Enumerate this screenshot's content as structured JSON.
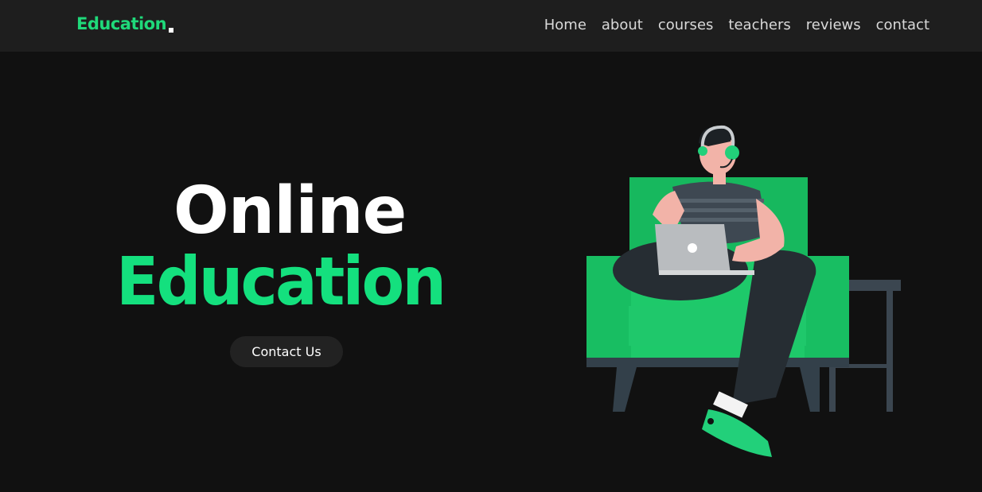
{
  "header": {
    "logo_text": "Education",
    "nav": [
      "Home",
      "about",
      "courses",
      "teachers",
      "reviews",
      "contact"
    ]
  },
  "hero": {
    "title_line1": "Online",
    "title_line2": "Education",
    "cta_label": "Contact Us"
  },
  "colors": {
    "accent": "#14e07e",
    "background": "#111111",
    "header_bg": "#1e1e1e",
    "button_bg": "#222222"
  },
  "icons": {
    "illustration": "student-on-couch-with-laptop-illustration"
  }
}
